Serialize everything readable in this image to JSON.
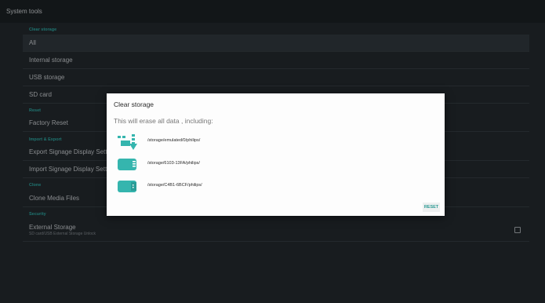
{
  "header": {
    "title": "System tools"
  },
  "sections": {
    "clear_storage": "Clear storage",
    "reset": "Reset",
    "import_export": "Import & Export",
    "clone": "Clone",
    "security": "Security"
  },
  "items": {
    "all": "All",
    "internal_storage": "Internal storage",
    "usb_storage": "USB storage",
    "sd_card": "SD card",
    "factory_reset": "Factory Reset",
    "export_settings": "Export Signage Display Settin",
    "import_settings": "Import Signage Display Settin",
    "clone_media": "Clone Media Files",
    "external_storage": "External Storage",
    "external_storage_sub": "SD card/USB External Storage Unlock"
  },
  "external_storage_unlock_checked": false,
  "dialog": {
    "title": "Clear storage",
    "message": "This will erase all data , including:",
    "paths": [
      {
        "icon": "internal-storage-icon",
        "path": "/storage/emulated/0/philips/"
      },
      {
        "icon": "sd-card-icon",
        "path": "/storage/6103-13FA/philips/"
      },
      {
        "icon": "usb-storage-icon",
        "path": "/storage/C4B1-6BCF/philips/"
      }
    ],
    "reset_label": "RESET"
  },
  "colors": {
    "accent": "#30b2ac",
    "background": "#252b30",
    "topbar": "#1d2226",
    "dialog": "#fdfdfd"
  }
}
